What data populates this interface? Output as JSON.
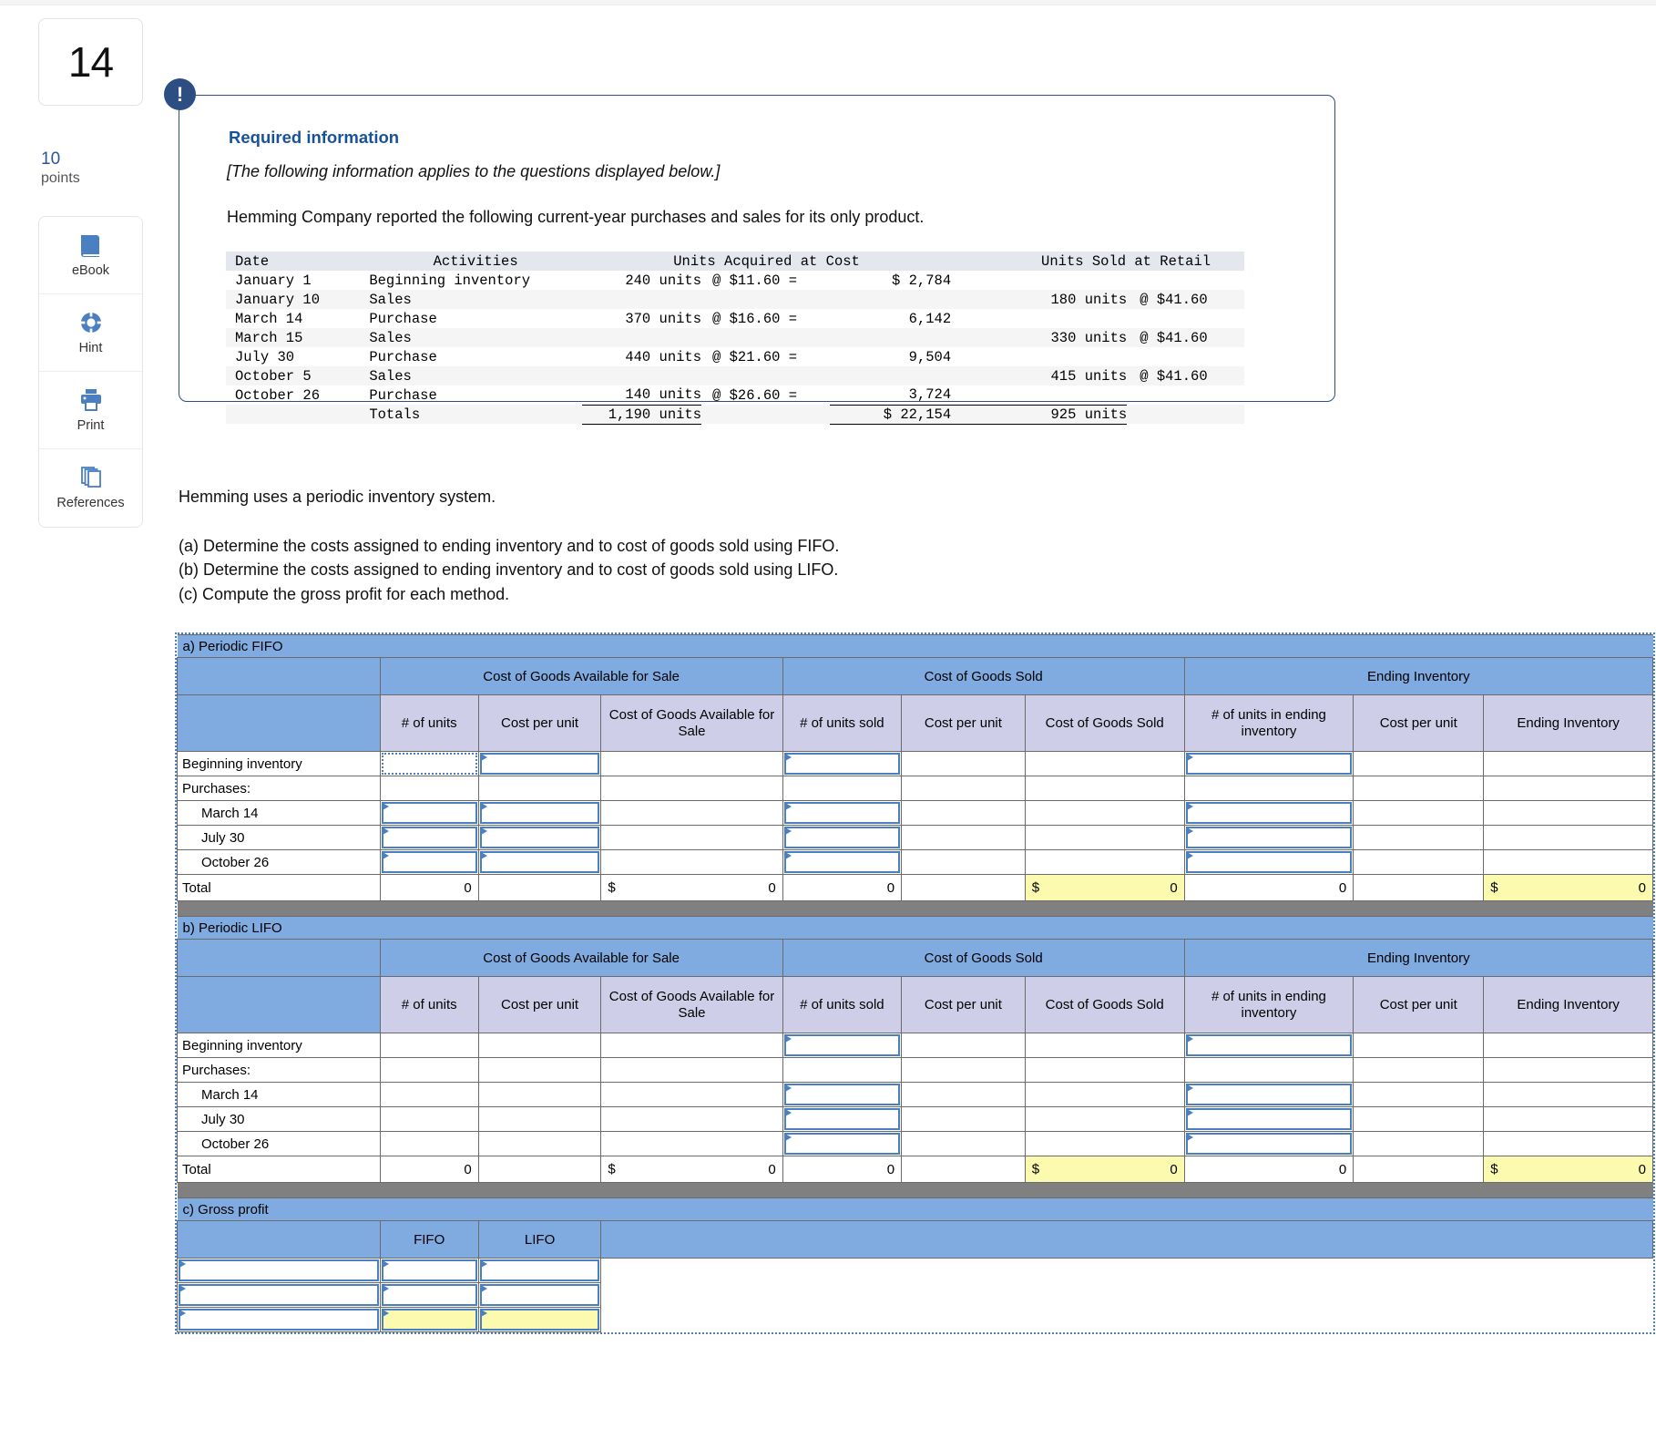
{
  "rail": {
    "question_number": "14",
    "points_value": "10",
    "points_label": "points",
    "tools": [
      {
        "name": "ebook",
        "label": "eBook",
        "icon": "book-icon"
      },
      {
        "name": "hint",
        "label": "Hint",
        "icon": "life-ring-icon"
      },
      {
        "name": "print",
        "label": "Print",
        "icon": "printer-icon"
      },
      {
        "name": "references",
        "label": "References",
        "icon": "pages-stack-icon"
      }
    ]
  },
  "info_card": {
    "alert_icon": "exclamation-icon",
    "title": "Required information",
    "italic_note": "[The following information applies to the questions displayed below.]",
    "body": "Hemming Company reported the following current-year purchases and sales for its only product."
  },
  "data_table": {
    "headers": {
      "date": "Date",
      "activities": "Activities",
      "acquired": "Units Acquired at Cost",
      "sold": "Units Sold at Retail"
    },
    "rows": [
      {
        "date": "January 1",
        "activity": "Beginning inventory",
        "units": "240 units",
        "at": "@ $11.60  =",
        "amount": "$ 2,784",
        "sold_units": "",
        "sold_at": ""
      },
      {
        "date": "January 10",
        "activity": "Sales",
        "units": "",
        "at": "",
        "amount": "",
        "sold_units": "180 units",
        "sold_at": "@ $41.60"
      },
      {
        "date": "March 14",
        "activity": "Purchase",
        "units": "370 units",
        "at": "@ $16.60  =",
        "amount": "6,142",
        "sold_units": "",
        "sold_at": ""
      },
      {
        "date": "March 15",
        "activity": "Sales",
        "units": "",
        "at": "",
        "amount": "",
        "sold_units": "330 units",
        "sold_at": "@ $41.60"
      },
      {
        "date": "July 30",
        "activity": "Purchase",
        "units": "440 units",
        "at": "@ $21.60  =",
        "amount": "9,504",
        "sold_units": "",
        "sold_at": ""
      },
      {
        "date": "October 5",
        "activity": "Sales",
        "units": "",
        "at": "",
        "amount": "",
        "sold_units": "415 units",
        "sold_at": "@ $41.60"
      },
      {
        "date": "October 26",
        "activity": "Purchase",
        "units": "140 units",
        "at": "@ $26.60  =",
        "amount": "3,724",
        "sold_units": "",
        "sold_at": ""
      }
    ],
    "totals": {
      "label": "Totals",
      "units": "1,190 units",
      "amount": "$ 22,154",
      "sold_units": "925 units"
    }
  },
  "prose": {
    "line1": "Hemming uses a periodic inventory system.",
    "line_a": "(a) Determine the costs assigned to ending inventory and to cost of goods sold using FIFO.",
    "line_b": "(b) Determine the costs assigned to ending inventory and to cost of goods sold using LIFO.",
    "line_c": "(c) Compute the gross profit for each method."
  },
  "worksheet": {
    "group_headers": {
      "available": "Cost of Goods Available for Sale",
      "cogs": "Cost of Goods Sold",
      "ending": "Ending Inventory"
    },
    "sub_headers": {
      "units": "# of units",
      "cost_per_unit": "Cost per unit",
      "cogafs": "Cost of Goods Available for Sale",
      "units_sold": "# of units sold",
      "cost_per_unit_2": "Cost per unit",
      "cogs": "Cost of Goods Sold",
      "units_ending": "# of units in ending inventory",
      "cost_per_unit_3": "Cost per unit",
      "ending_inventory": "Ending Inventory"
    },
    "row_labels": {
      "beginning": "Beginning inventory",
      "purchases": "Purchases:",
      "march": "March 14",
      "july": "July 30",
      "october": "October 26",
      "total": "Total"
    },
    "fifo": {
      "title": "a) Periodic FIFO",
      "totals": {
        "units": "0",
        "cost_per_unit": "",
        "cogafs_dollar": "$",
        "cogafs": "0",
        "units_sold": "0",
        "cogs_cpu": "",
        "cogs_dollar": "$",
        "cogs": "0",
        "units_ending": "0",
        "ending_cpu": "",
        "ending_dollar": "$",
        "ending": "0"
      }
    },
    "lifo": {
      "title": "b) Periodic LIFO",
      "totals": {
        "units": "0",
        "cost_per_unit": "",
        "cogafs_dollar": "$",
        "cogafs": "0",
        "units_sold": "0",
        "cogs_cpu": "",
        "cogs_dollar": "$",
        "cogs": "0",
        "units_ending": "0",
        "ending_cpu": "",
        "ending_dollar": "$",
        "ending": "0"
      }
    },
    "gross_profit": {
      "title": "c) Gross profit",
      "col_fifo": "FIFO",
      "col_lifo": "LIFO",
      "rows": [
        {
          "label": "",
          "fifo": "",
          "lifo": ""
        },
        {
          "label": "",
          "fifo": "",
          "lifo": ""
        },
        {
          "label": "",
          "fifo": "",
          "lifo": ""
        }
      ]
    }
  },
  "colors": {
    "header_blue": "#80abe0",
    "subheader_lavender": "#cfcee8",
    "input_border": "#4a7fc1",
    "highlight_yellow": "#fcfaaf",
    "separator_gray": "#808080",
    "alert_navy": "#2c4e82",
    "link_blue": "#19529b"
  }
}
